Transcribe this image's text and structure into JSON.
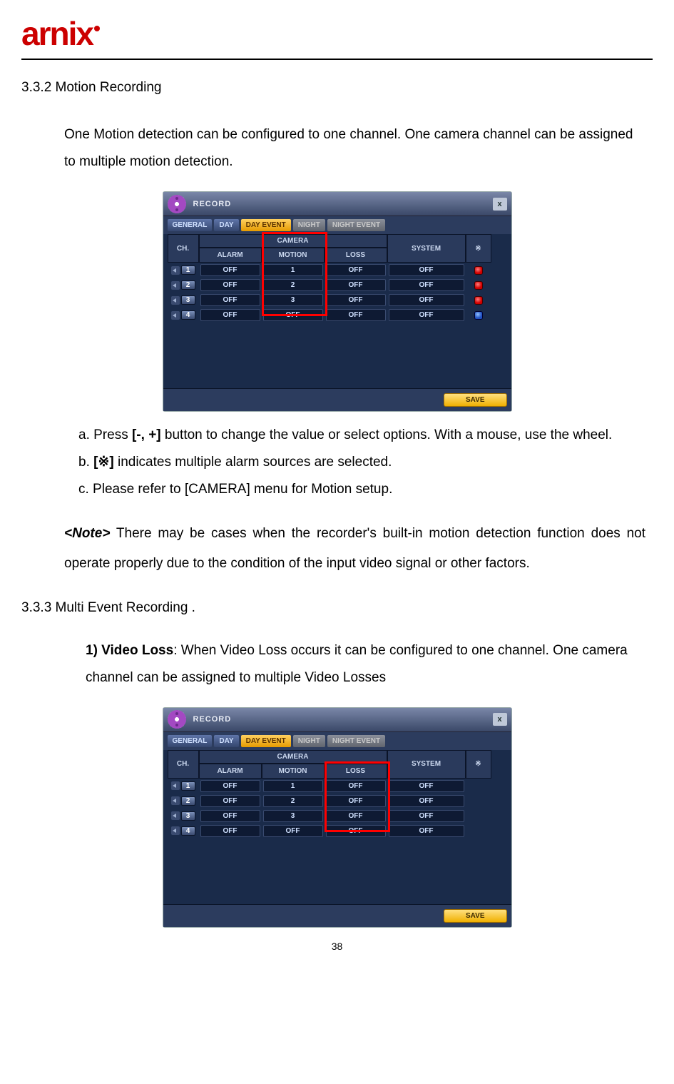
{
  "logo": "arnix",
  "section_332_title": "3.3.2 Motion Recording",
  "intro_332": "One Motion detection can be configured to one channel. One camera channel can be assigned to multiple motion detection.",
  "list_332": {
    "a_pre": "a.   Press ",
    "a_bold": "[-, +]",
    "a_post": " button to change the value or select options. With a mouse, use the wheel.",
    "b_pre": "b.    ",
    "b_bold": "[※]",
    "b_post": " indicates multiple alarm sources are selected.",
    "c": "c.    Please refer to [CAMERA] menu for Motion setup."
  },
  "note_332_lead": "<Note>",
  "note_332_body": " There may be cases when the recorder's built-in motion detection function does not operate properly due to the condition of the input video signal or other factors.",
  "section_333_title": "3.3.3 Multi Event Recording        .",
  "sub333_1_lead": "1) Video Loss",
  "sub333_1_body": ": When Video Loss occurs it can be configured to one channel. One camera channel can be assigned to multiple Video Losses",
  "page_number": "38",
  "panel": {
    "title": "RECORD",
    "close": "x",
    "tabs": {
      "general": "GENERAL",
      "day": "DAY",
      "dayevent": "DAY EVENT",
      "night": "NIGHT",
      "nightevent": "NIGHT EVENT"
    },
    "headers": {
      "ch": "CH.",
      "camera": "CAMERA",
      "alarm": "ALARM",
      "motion": "MOTION",
      "loss": "LOSS",
      "system": "SYSTEM",
      "mark": "※"
    },
    "save": "SAVE",
    "rows1": [
      {
        "ch": "1",
        "alarm": "OFF",
        "motion": "1",
        "loss": "OFF",
        "system": "OFF",
        "dot": "red"
      },
      {
        "ch": "2",
        "alarm": "OFF",
        "motion": "2",
        "loss": "OFF",
        "system": "OFF",
        "dot": "red"
      },
      {
        "ch": "3",
        "alarm": "OFF",
        "motion": "3",
        "loss": "OFF",
        "system": "OFF",
        "dot": "red"
      },
      {
        "ch": "4",
        "alarm": "OFF",
        "motion": "OFF",
        "loss": "OFF",
        "system": "OFF",
        "dot": "blue"
      }
    ],
    "rows2": [
      {
        "ch": "1",
        "alarm": "OFF",
        "motion": "1",
        "loss": "OFF",
        "system": "OFF"
      },
      {
        "ch": "2",
        "alarm": "OFF",
        "motion": "2",
        "loss": "OFF",
        "system": "OFF"
      },
      {
        "ch": "3",
        "alarm": "OFF",
        "motion": "3",
        "loss": "OFF",
        "system": "OFF"
      },
      {
        "ch": "4",
        "alarm": "OFF",
        "motion": "OFF",
        "loss": "OFF",
        "system": "OFF"
      }
    ]
  }
}
